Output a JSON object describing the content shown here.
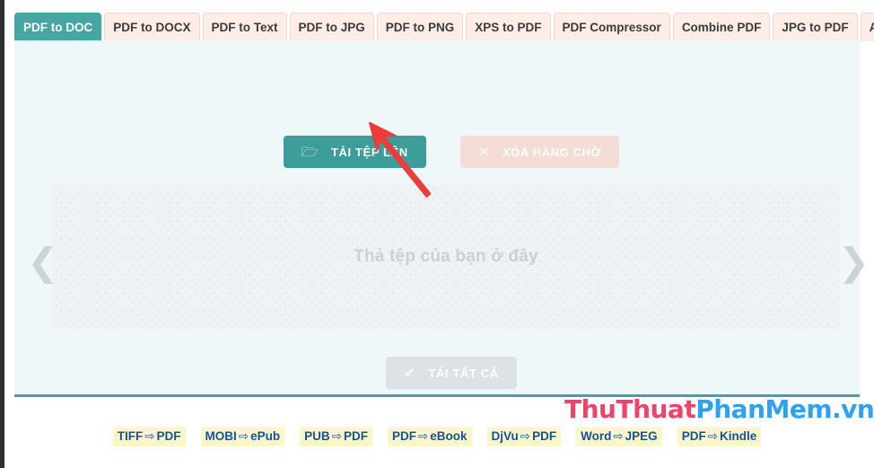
{
  "tabs": [
    {
      "label": "PDF to DOC",
      "active": true
    },
    {
      "label": "PDF to DOCX",
      "active": false
    },
    {
      "label": "PDF to Text",
      "active": false
    },
    {
      "label": "PDF to JPG",
      "active": false
    },
    {
      "label": "PDF to PNG",
      "active": false
    },
    {
      "label": "XPS to PDF",
      "active": false
    },
    {
      "label": "PDF Compressor",
      "active": false
    },
    {
      "label": "Combine PDF",
      "active": false
    },
    {
      "label": "JPG to PDF",
      "active": false
    },
    {
      "label": "Any to PDF",
      "active": false
    }
  ],
  "actions": {
    "upload_label": "TẢI TỆP LÊN",
    "upload_icon": "folder-open-icon",
    "upload_icon_glyph": "🗁",
    "clear_label": "XÓA HÀNG CHỜ",
    "clear_icon": "close-x-icon",
    "clear_icon_glyph": "✕",
    "download_label": "TẢI TẤT CẢ",
    "download_icon": "check-icon",
    "download_icon_glyph": "✔"
  },
  "dropzone": {
    "text": "Thả tệp của bạn ở đây"
  },
  "carousel": {
    "prev_glyph": "❮",
    "next_glyph": "❯"
  },
  "watermark": {
    "part1": "ThuThuat",
    "part2": "PhanMem.vn"
  },
  "quick_links": [
    {
      "from": "TIFF",
      "arrow": "⇨",
      "to": "PDF"
    },
    {
      "from": "MOBI",
      "arrow": "⇨",
      "to": "ePub"
    },
    {
      "from": "PUB",
      "arrow": "⇨",
      "to": "PDF"
    },
    {
      "from": "PDF",
      "arrow": "⇨",
      "to": "eBook"
    },
    {
      "from": "DjVu",
      "arrow": "⇨",
      "to": "PDF"
    },
    {
      "from": "Word",
      "arrow": "⇨",
      "to": "JPEG"
    },
    {
      "from": "PDF",
      "arrow": "⇨",
      "to": "Kindle"
    }
  ],
  "annotation": {
    "type": "arrow",
    "color": "#ee3b3b",
    "points_to": "upload-button"
  },
  "colors": {
    "accent_teal": "#3d9d9b",
    "tab_inactive": "#fdede7",
    "panel_bg": "#f0f7f9",
    "dropzone_bg": "#eef2f4",
    "clear_btn": "#f3ddd4",
    "download_btn": "#dde3e4",
    "link_highlight": "#fdf6c9",
    "link_text": "#14539a",
    "watermark_pink": "#f0436b",
    "watermark_blue": "#2ca2f0"
  }
}
